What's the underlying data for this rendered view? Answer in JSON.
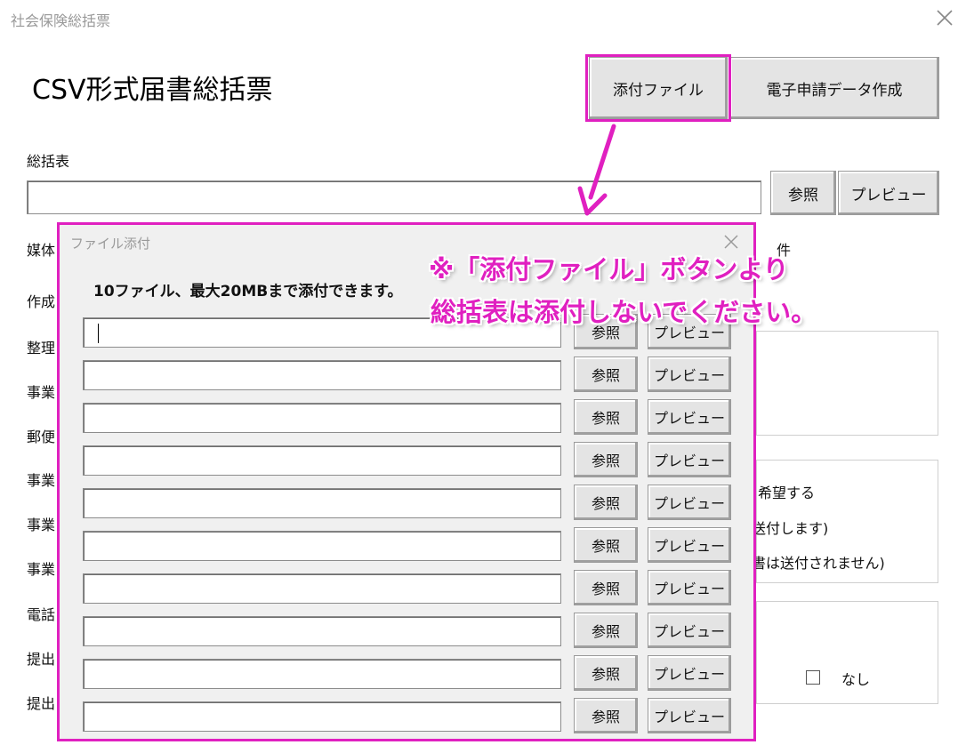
{
  "window": {
    "title": "社会保険総括票"
  },
  "page": {
    "title": "CSV形式届書総括票"
  },
  "toolbar": {
    "attach_label": "添付ファイル",
    "create_label": "電子申請データ作成"
  },
  "summary": {
    "label": "総括表",
    "browse_label": "参照",
    "preview_label": "プレビュー"
  },
  "form_labels": [
    "媒体",
    "作成",
    "整理",
    "事業",
    "郵便",
    "事業",
    "事業",
    "事業",
    "電話",
    "提出",
    "提出"
  ],
  "right_fragments": {
    "count_unit": "件",
    "option_wish": "希望する",
    "option_send": "送付します)",
    "option_nosend": "書は送付されません)",
    "option_none": "なし"
  },
  "dialog": {
    "title": "ファイル添付",
    "header": "10ファイル、最大20MBまで添付できます。",
    "browse_label": "参照",
    "preview_label": "プレビュー",
    "rows": [
      "",
      "",
      "",
      "",
      "",
      "",
      "",
      "",
      "",
      ""
    ]
  },
  "annotation": {
    "line1": "※「添付ファイル」ボタンより",
    "line2": "総括表は添付しないでください。",
    "color": "#e020c0"
  }
}
